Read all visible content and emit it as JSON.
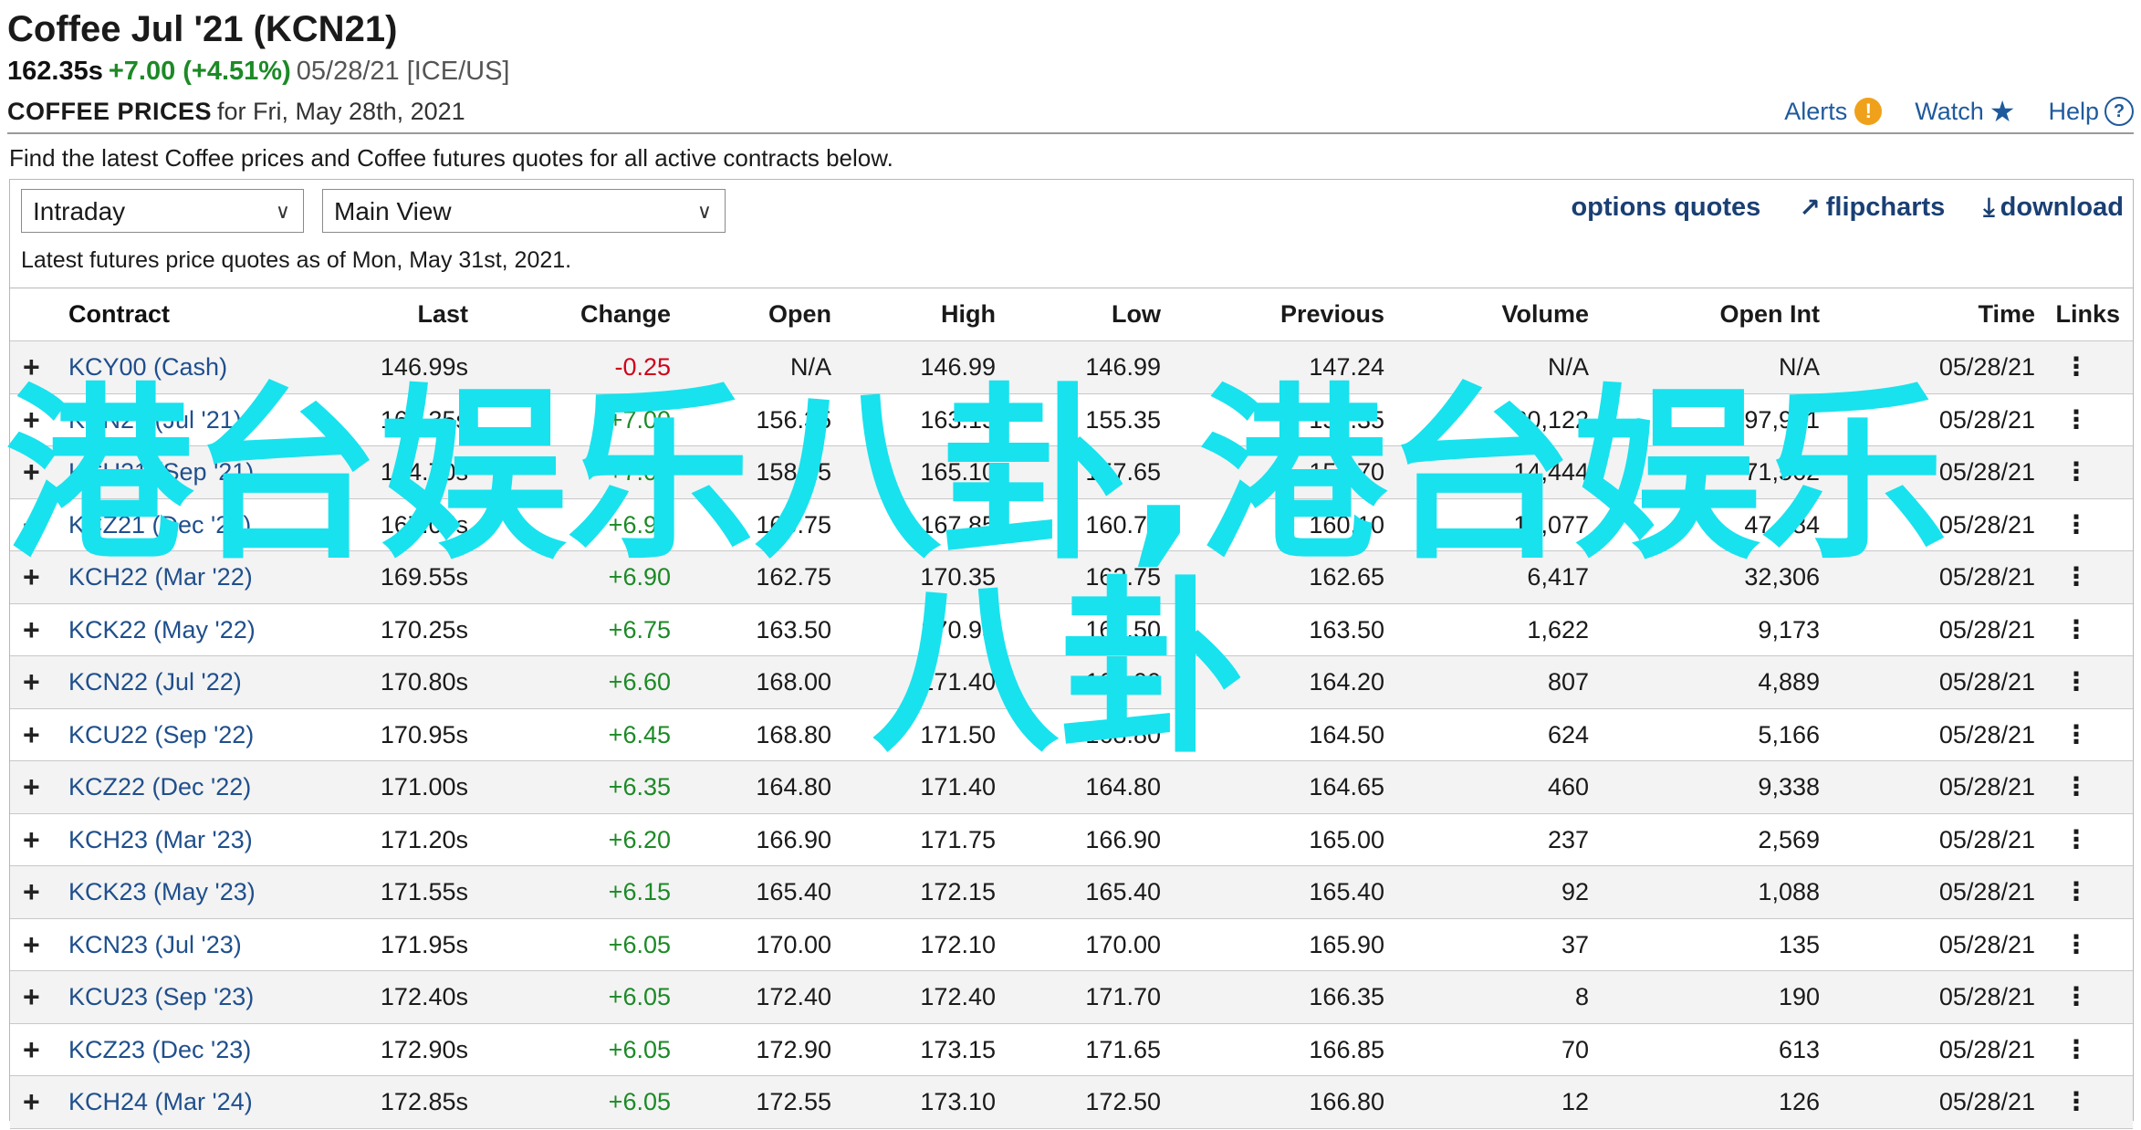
{
  "header": {
    "title": "Coffee Jul '21 (KCN21)",
    "price": "162.35s",
    "change": "+7.00 (+4.51%)",
    "meta": "05/28/21 [ICE/US]",
    "prices_label": "COFFEE PRICES",
    "prices_date": "for Fri, May 28th, 2021",
    "links": {
      "alerts": "Alerts",
      "watch": "Watch",
      "help": "Help"
    }
  },
  "intro_text": "Find the latest Coffee prices and Coffee futures quotes for all active contracts below.",
  "controls": {
    "interval_select": "Intraday",
    "view_select": "Main View",
    "options_quotes": "options quotes",
    "flipcharts": "flipcharts",
    "download": "download"
  },
  "as_of": "Latest futures price quotes as of Mon, May 31st, 2021.",
  "table": {
    "headers": {
      "contract": "Contract",
      "last": "Last",
      "change": "Change",
      "open": "Open",
      "high": "High",
      "low": "Low",
      "previous": "Previous",
      "volume": "Volume",
      "open_int": "Open Int",
      "time": "Time",
      "links": "Links"
    },
    "rows": [
      {
        "contract": "KCY00 (Cash)",
        "last": "146.99s",
        "change": "-0.25",
        "open": "N/A",
        "high": "146.99",
        "low": "146.99",
        "previous": "147.24",
        "volume": "N/A",
        "open_int": "N/A",
        "time": "05/28/21"
      },
      {
        "contract": "KCN21 (Jul '21)",
        "last": "162.35s",
        "change": "+7.00",
        "open": "156.35",
        "high": "163.15",
        "low": "155.35",
        "previous": "155.35",
        "volume": "30,122",
        "open_int": "97,991",
        "time": "05/28/21"
      },
      {
        "contract": "KCU21 (Sep '21)",
        "last": "164.70s",
        "change": "+7.00",
        "open": "158.25",
        "high": "165.10",
        "low": "157.65",
        "previous": "157.70",
        "volume": "14,444",
        "open_int": "71,562",
        "time": "05/28/21"
      },
      {
        "contract": "KCZ21 (Dec '21)",
        "last": "167.05s",
        "change": "+6.90",
        "open": "160.75",
        "high": "167.85",
        "low": "160.75",
        "previous": "160.10",
        "volume": "10,077",
        "open_int": "47,284",
        "time": "05/28/21"
      },
      {
        "contract": "KCH22 (Mar '22)",
        "last": "169.55s",
        "change": "+6.90",
        "open": "162.75",
        "high": "170.35",
        "low": "162.75",
        "previous": "162.65",
        "volume": "6,417",
        "open_int": "32,306",
        "time": "05/28/21"
      },
      {
        "contract": "KCK22 (May '22)",
        "last": "170.25s",
        "change": "+6.75",
        "open": "163.50",
        "high": "170.95",
        "low": "163.50",
        "previous": "163.50",
        "volume": "1,622",
        "open_int": "9,173",
        "time": "05/28/21"
      },
      {
        "contract": "KCN22 (Jul '22)",
        "last": "170.80s",
        "change": "+6.60",
        "open": "168.00",
        "high": "171.40",
        "low": "168.00",
        "previous": "164.20",
        "volume": "807",
        "open_int": "4,889",
        "time": "05/28/21"
      },
      {
        "contract": "KCU22 (Sep '22)",
        "last": "170.95s",
        "change": "+6.45",
        "open": "168.80",
        "high": "171.50",
        "low": "168.80",
        "previous": "164.50",
        "volume": "624",
        "open_int": "5,166",
        "time": "05/28/21"
      },
      {
        "contract": "KCZ22 (Dec '22)",
        "last": "171.00s",
        "change": "+6.35",
        "open": "164.80",
        "high": "171.40",
        "low": "164.80",
        "previous": "164.65",
        "volume": "460",
        "open_int": "9,338",
        "time": "05/28/21"
      },
      {
        "contract": "KCH23 (Mar '23)",
        "last": "171.20s",
        "change": "+6.20",
        "open": "166.90",
        "high": "171.75",
        "low": "166.90",
        "previous": "165.00",
        "volume": "237",
        "open_int": "2,569",
        "time": "05/28/21"
      },
      {
        "contract": "KCK23 (May '23)",
        "last": "171.55s",
        "change": "+6.15",
        "open": "165.40",
        "high": "172.15",
        "low": "165.40",
        "previous": "165.40",
        "volume": "92",
        "open_int": "1,088",
        "time": "05/28/21"
      },
      {
        "contract": "KCN23 (Jul '23)",
        "last": "171.95s",
        "change": "+6.05",
        "open": "170.00",
        "high": "172.10",
        "low": "170.00",
        "previous": "165.90",
        "volume": "37",
        "open_int": "135",
        "time": "05/28/21"
      },
      {
        "contract": "KCU23 (Sep '23)",
        "last": "172.40s",
        "change": "+6.05",
        "open": "172.40",
        "high": "172.40",
        "low": "171.70",
        "previous": "166.35",
        "volume": "8",
        "open_int": "190",
        "time": "05/28/21"
      },
      {
        "contract": "KCZ23 (Dec '23)",
        "last": "172.90s",
        "change": "+6.05",
        "open": "172.90",
        "high": "173.15",
        "low": "171.65",
        "previous": "166.85",
        "volume": "70",
        "open_int": "613",
        "time": "05/28/21"
      },
      {
        "contract": "KCH24 (Mar '24)",
        "last": "172.85s",
        "change": "+6.05",
        "open": "172.55",
        "high": "173.10",
        "low": "172.50",
        "previous": "166.80",
        "volume": "12",
        "open_int": "126",
        "time": "05/28/21"
      }
    ]
  },
  "watermark": {
    "line1": "港台娱乐八卦,港台娱乐",
    "line2": "八卦"
  },
  "colors": {
    "link": "#1f5a9c",
    "positive": "#1c8a26",
    "negative": "#d0021b",
    "watermark": "#18e2ee",
    "alert": "#f0a11b"
  }
}
